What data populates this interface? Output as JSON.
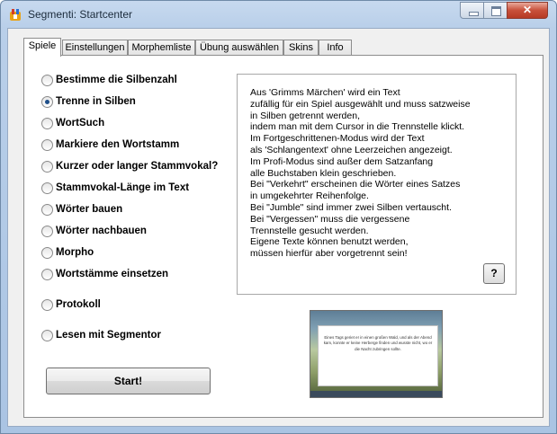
{
  "window": {
    "title": "Segmenti: Startcenter",
    "icon": "segmenti-app-icon",
    "controls": {
      "minimize": "minimize-icon",
      "maximize": "maximize-icon",
      "close": "close-icon",
      "close_glyph": "✕"
    }
  },
  "tabs": [
    {
      "label": "Spiele",
      "active": true
    },
    {
      "label": "Einstellungen",
      "active": false
    },
    {
      "label": "Morphemliste",
      "active": false
    },
    {
      "label": "Übung auswählen",
      "active": false
    },
    {
      "label": "Skins",
      "active": false
    },
    {
      "label": "Info",
      "active": false
    }
  ],
  "games": {
    "options": [
      {
        "label": "Bestimme die Silbenzahl",
        "checked": false
      },
      {
        "label": "Trenne in Silben",
        "checked": true
      },
      {
        "label": "WortSuch",
        "checked": false
      },
      {
        "label": "Markiere den Wortstamm",
        "checked": false
      },
      {
        "label": "Kurzer oder langer Stammvokal?",
        "checked": false
      },
      {
        "label": "Stammvokal-Länge im Text",
        "checked": false
      },
      {
        "label": "Wörter bauen",
        "checked": false
      },
      {
        "label": "Wörter nachbauen",
        "checked": false
      },
      {
        "label": "Morpho",
        "checked": false
      },
      {
        "label": "Wortstämme einsetzen",
        "checked": false
      },
      {
        "label": "Protokoll",
        "checked": false
      },
      {
        "label": "Lesen mit Segmentor",
        "checked": false
      }
    ]
  },
  "description": {
    "lines": [
      "Aus 'Grimms Märchen' wird ein Text",
      "zufällig für ein Spiel ausgewählt und muss satzweise",
      "in Silben getrennt werden,",
      "indem man mit dem Cursor in die Trennstelle klickt.",
      "Im Fortgeschrittenen-Modus wird der Text",
      "als 'Schlangentext' ohne Leerzeichen angezeigt.",
      "Im Profi-Modus sind außer dem Satzanfang",
      "alle Buchstaben klein geschrieben.",
      "Bei \"Verkehrt\" erscheinen die Wörter eines Satzes",
      "in umgekehrter Reihenfolge.",
      "Bei \"Jumble\" sind immer zwei Silben vertauscht.",
      "Bei \"Vergessen\" muss die vergessene",
      "Trennstelle gesucht werden.",
      "Eigene Texte können benutzt werden,",
      "müssen hierfür aber vorgetrennt sein!"
    ],
    "help_label": "?"
  },
  "start_label": "Start!",
  "preview": {
    "text": "Eines Tags geriet er in einen großen Wald, und als der Abend kam, konnte er keine Herberge finden und wusste nicht, wo er die Nacht zubringen sollte."
  }
}
